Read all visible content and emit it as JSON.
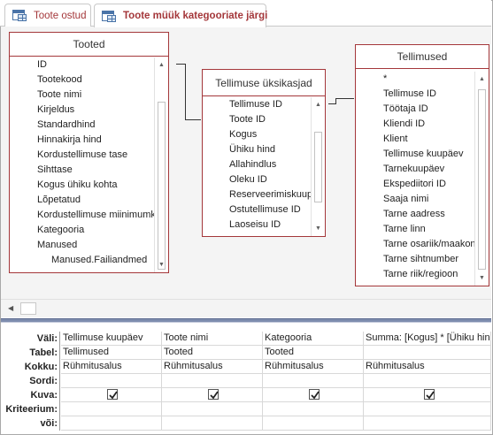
{
  "tabs": [
    {
      "label": "Toote ostud",
      "active": false
    },
    {
      "label": "Toote müük kategooriate järgi",
      "active": true
    }
  ],
  "tables": {
    "tooted": {
      "title": "Tooted",
      "fields": [
        "ID",
        "Tootekood",
        "Toote nimi",
        "Kirjeldus",
        "Standardhind",
        "Hinnakirja hind",
        "Kordustellimuse tase",
        "Sihttase",
        "Kogus ühiku kohta",
        "Lõpetatud",
        "Kordustellimuse miinimumk",
        "Kategooria",
        "Manused",
        "Manused.Failiandmed"
      ]
    },
    "tellimuse_uksikasjad": {
      "title": "Tellimuse üksikasjad",
      "fields": [
        "Tellimuse ID",
        "Toote ID",
        "Kogus",
        "Ühiku hind",
        "Allahindlus",
        "Oleku ID",
        "Reserveerimiskuupä",
        "Ostutellimuse ID",
        "Laoseisu ID"
      ]
    },
    "tellimused": {
      "title": "Tellimused",
      "fields": [
        "*",
        "Tellimuse ID",
        "Töötaja ID",
        "Kliendi ID",
        "Klient",
        "Tellimuse kuupäev",
        "Tarnekuupäev",
        "Ekspediitori ID",
        "Saaja nimi",
        "Tarne aadress",
        "Tarne linn",
        "Tarne osariik/maakon",
        "Tarne sihtnumber",
        "Tarne riik/regioon"
      ]
    }
  },
  "query_grid": {
    "row_labels": [
      "Väli:",
      "Tabel:",
      "Kokku:",
      "Sordi:",
      "Kuva:",
      "Kriteerium:",
      "või:"
    ],
    "columns": [
      {
        "field": "Tellimuse kuupäev",
        "table": "Tellimused",
        "total": "Rühmitusalus",
        "sort": "",
        "show": true
      },
      {
        "field": "Toote nimi",
        "table": "Tooted",
        "total": "Rühmitusalus",
        "sort": "",
        "show": true
      },
      {
        "field": "Kategooria",
        "table": "Tooted",
        "total": "Rühmitusalus",
        "sort": "",
        "show": true
      },
      {
        "field": "Summa: [Kogus] * [Ühiku hind",
        "table": "",
        "total": "Rühmitusalus",
        "sort": "",
        "show": true
      }
    ]
  },
  "colors": {
    "accent": "#a4373a",
    "splitter": "#7e8cae",
    "diagram_bg": "#f4f4f4"
  }
}
